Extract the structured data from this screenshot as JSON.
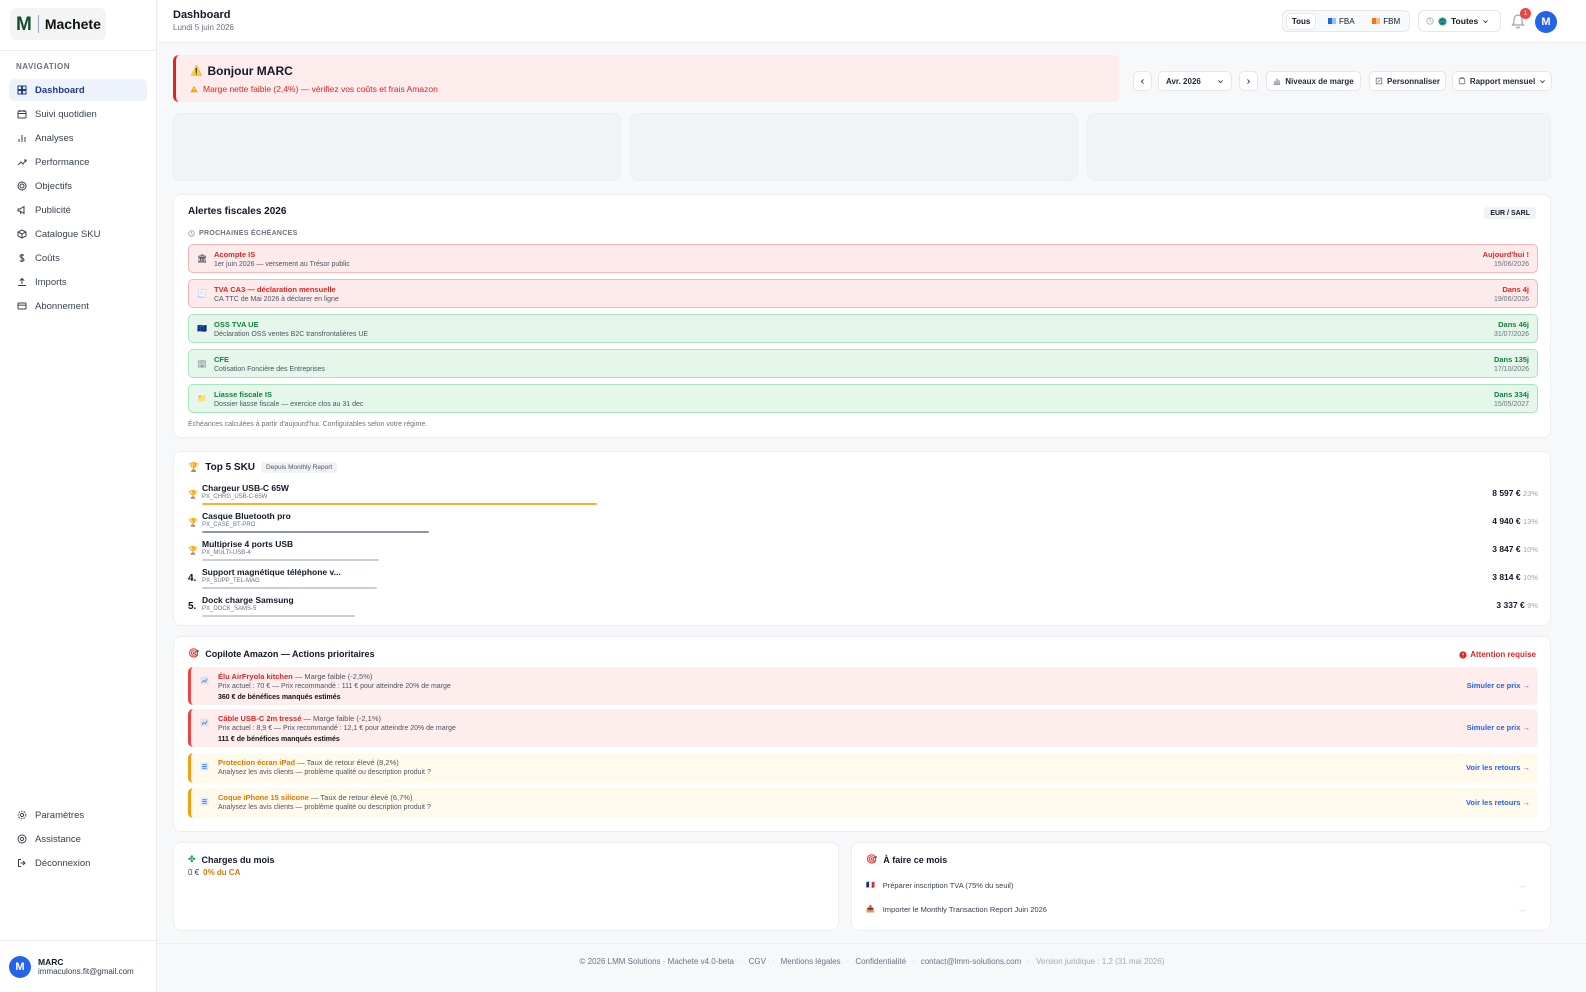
{
  "brand": {
    "mark": "M",
    "name": "Machete"
  },
  "sidebar": {
    "nav_title": "NAVIGATION",
    "items": [
      {
        "label": "Dashboard",
        "icon": "grid-icon",
        "active": true
      },
      {
        "label": "Suivi quotidien",
        "icon": "calendar-icon"
      },
      {
        "label": "Analyses",
        "icon": "bar-chart-icon"
      },
      {
        "label": "Performance",
        "icon": "trend-icon"
      },
      {
        "label": "Objectifs",
        "icon": "target-icon"
      },
      {
        "label": "Publicité",
        "icon": "megaphone-icon"
      },
      {
        "label": "Catalogue SKU",
        "icon": "box-icon"
      },
      {
        "label": "Coûts",
        "icon": "dollar-icon"
      },
      {
        "label": "Imports",
        "icon": "upload-icon"
      },
      {
        "label": "Abonnement",
        "icon": "card-icon"
      }
    ],
    "bottom_items": [
      {
        "label": "Paramètres",
        "icon": "gear-icon"
      },
      {
        "label": "Assistance",
        "icon": "help-icon"
      },
      {
        "label": "Déconnexion",
        "icon": "logout-icon"
      }
    ],
    "user": {
      "initial": "M",
      "name": "MARC",
      "email": "immaculons.fit@gmail.com"
    }
  },
  "topbar": {
    "title": "Dashboard",
    "date": "Lundi 5 juin 2026",
    "segments": [
      {
        "label": "Tous",
        "active": true
      },
      {
        "label": "FBA"
      },
      {
        "label": "FBM"
      }
    ],
    "marketplace": "Toutes",
    "notif_count": "1",
    "avatar": "M"
  },
  "hello": {
    "title": "Bonjour MARC",
    "message": "Marge nette faible (2,4%) — vérifiez vos coûts et frais Amazon"
  },
  "controls": {
    "month": "Avr. 2026",
    "margin_levels": "Niveaux de marge",
    "customize": "Personnaliser",
    "report": "Rapport mensuel"
  },
  "fiscal": {
    "title": "Alertes fiscales 2026",
    "badge": "EUR / SARL",
    "section": "PROCHAINES ÉCHÉANCES",
    "items": [
      {
        "name": "Acompte IS",
        "desc": "1er juin 2026 — versement au Trésor public",
        "when": "Aujourd'hui !",
        "date": "15/06/2026",
        "status": "red",
        "icon": "🏛"
      },
      {
        "name": "TVA CA3 — déclaration mensuelle",
        "desc": "CA TTC de Mai 2026 à déclarer en ligne",
        "when": "Dans 4j",
        "date": "19/06/2026",
        "status": "red",
        "icon": "🧾"
      },
      {
        "name": "OSS TVA UE",
        "desc": "Déclaration OSS ventes B2C transfrontalières UE",
        "when": "Dans 46j",
        "date": "31/07/2026",
        "status": "green",
        "icon": "🇪🇺"
      },
      {
        "name": "CFE",
        "desc": "Cotisation Foncière des Entreprises",
        "when": "Dans 135j",
        "date": "17/10/2026",
        "status": "green",
        "icon": "🏢"
      },
      {
        "name": "Liasse fiscale IS",
        "desc": "Dossier liasse fiscale — exercice clos au 31 dec",
        "when": "Dans 334j",
        "date": "15/05/2027",
        "status": "green",
        "icon": "📁"
      }
    ],
    "note": "Échéances calculées à partir d'aujourd'hui. Configurables selon votre régime."
  },
  "top_sku": {
    "title": "Top 5 SKU",
    "badge": "Depuis Monthly Report",
    "items": [
      {
        "rank": "🏆",
        "name": "Chargeur USB-C 65W",
        "code": "PX_CHRG_USB-C-65W",
        "value": "8 597 €",
        "pct": "23%",
        "share": 1.0,
        "color": "#f5b42a"
      },
      {
        "rank": "🏆",
        "name": "Casque Bluetooth pro",
        "code": "PX_CASE_BT-PRO",
        "value": "4 940 €",
        "pct": "13%",
        "share": 0.575,
        "color": "#8d97b5"
      },
      {
        "rank": "🏆",
        "name": "Multiprise 4 ports USB",
        "code": "PX_MULTI-USB-4",
        "value": "3 847 €",
        "pct": "10%",
        "share": 0.447,
        "color": "#c9ced9"
      },
      {
        "rank": "4.",
        "name": "Support magnétique téléphone v...",
        "code": "PX_SUPP_TEL-MAG",
        "value": "3 814 €",
        "pct": "10%",
        "share": 0.444,
        "color": "#c9ced9"
      },
      {
        "rank": "5.",
        "name": "Dock charge Samsung",
        "code": "PX_DOCK_SAMS-5",
        "value": "3 337 €",
        "pct": "9%",
        "share": 0.388,
        "color": "#c9ced9"
      }
    ]
  },
  "copilot": {
    "title": "Copilote Amazon — Actions prioritaires",
    "attention": "Attention requise",
    "items": [
      {
        "name": "Élu AirFryola kitchen",
        "tag": " — Marge faible (-2,5%)",
        "l2": "Prix actuel : 70 € — Prix recommandé : 111 € pour atteindre 20% de marge",
        "l3": "360 € de bénéfices manqués estimés",
        "link": "Simuler ce prix →",
        "status": "red"
      },
      {
        "name": "Câble USB-C 2m tressé",
        "tag": " — Marge faible (-2,1%)",
        "l2": "Prix actuel : 8,9 € — Prix recommandé : 12,1 € pour atteindre 20% de marge",
        "l3": "111 € de bénéfices manqués estimés",
        "link": "Simuler ce prix →",
        "status": "red"
      },
      {
        "name": "Protection écran iPad",
        "tag": " — Taux de retour élevé (8,2%)",
        "l2": "Analysez les avis clients — problème qualité ou description produit ?",
        "l3": "",
        "link": "Voir les retours →",
        "status": "yel"
      },
      {
        "name": "Coque iPhone 15 silicone",
        "tag": " — Taux de retour élevé (6,7%)",
        "l2": "Analysez les avis clients — problème qualité ou description produit ?",
        "l3": "",
        "link": "Voir les retours →",
        "status": "yel"
      }
    ]
  },
  "charges": {
    "title": "Charges du mois",
    "amount": "0 €",
    "share": "0% du CA"
  },
  "todo": {
    "title": "À faire ce mois",
    "items": [
      {
        "label": "Préparer inscription TVA (75% du seuil)",
        "icon": "🇫🇷"
      },
      {
        "label": "Importer le Monthly Transaction Report Juin 2026",
        "icon": "📥"
      }
    ]
  },
  "footer": {
    "copyright": "© 2026 LMM Solutions · Machete v4.0-beta",
    "links": [
      "CGV",
      "Mentions légales",
      "Confidentialité",
      "contact@lmm-solutions.com"
    ],
    "version": "Version juridique : 1.2 (31 mai 2026)"
  },
  "colors": {
    "accent": "#2563eb",
    "danger": "#dc2626",
    "success": "#15803d",
    "warning": "#d97706",
    "brand": "#134e2e"
  }
}
